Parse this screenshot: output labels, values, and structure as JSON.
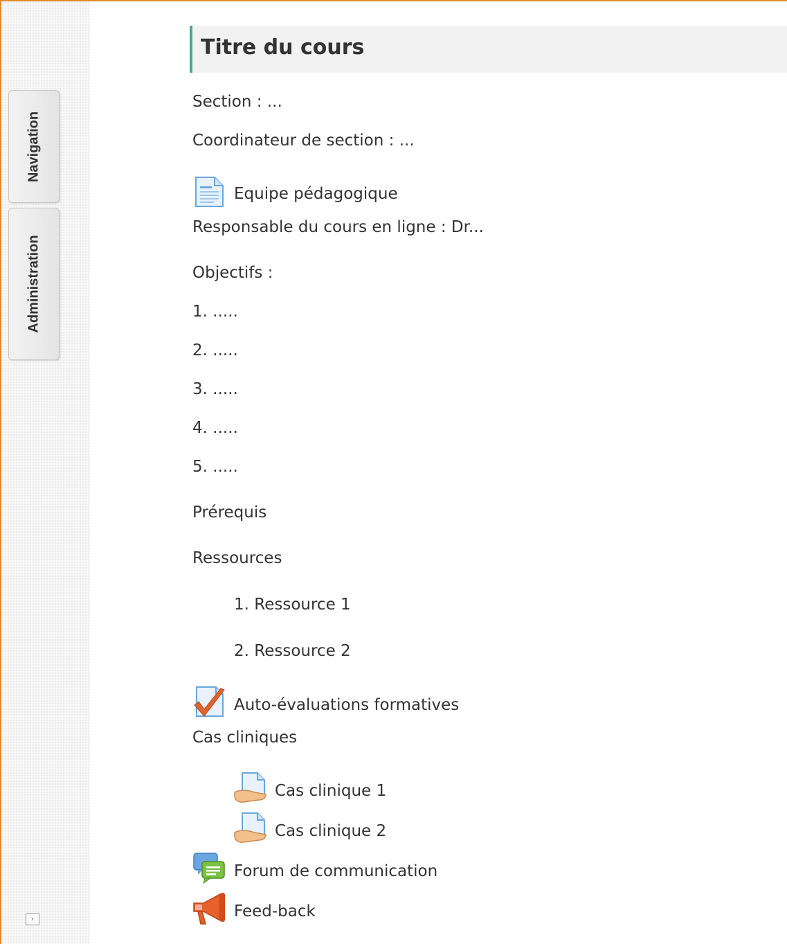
{
  "dock": {
    "tabs": [
      "Navigation",
      "Administration"
    ],
    "toggle_glyph": "›"
  },
  "course": {
    "title": "Titre du cours",
    "section": "Section : ...",
    "coordinator": "Coordinateur de section : ...",
    "team_link": "Equipe pédagogique",
    "online_lead": "Responsable du cours en ligne : Dr...",
    "objectives_label": "Objectifs :",
    "objectives": [
      "1. .....",
      "2. .....",
      "3. .....",
      "4. .....",
      "5. ....."
    ],
    "prerequisites": "Prérequis",
    "resources_label": "Ressources",
    "resources": [
      "1. Ressource 1",
      "2. Ressource 2"
    ],
    "self_assessment_link": "Auto-évaluations formatives",
    "clinical_label": "Cas cliniques",
    "clinical_cases": [
      "Cas clinique 1",
      "Cas clinique 2"
    ],
    "forum_link": "Forum de communication",
    "feedback_link": "Feed-back"
  },
  "colors": {
    "frame": "#e08a2c",
    "title_accent": "#4ea59a",
    "icon_blue": "#6aa7e0",
    "check_orange": "#e0652a",
    "forum_green": "#7cc242",
    "megaphone_orange": "#e8612a"
  },
  "icons": [
    "page-icon",
    "quiz-icon",
    "assignment-icon",
    "forum-icon",
    "feedback-icon"
  ]
}
